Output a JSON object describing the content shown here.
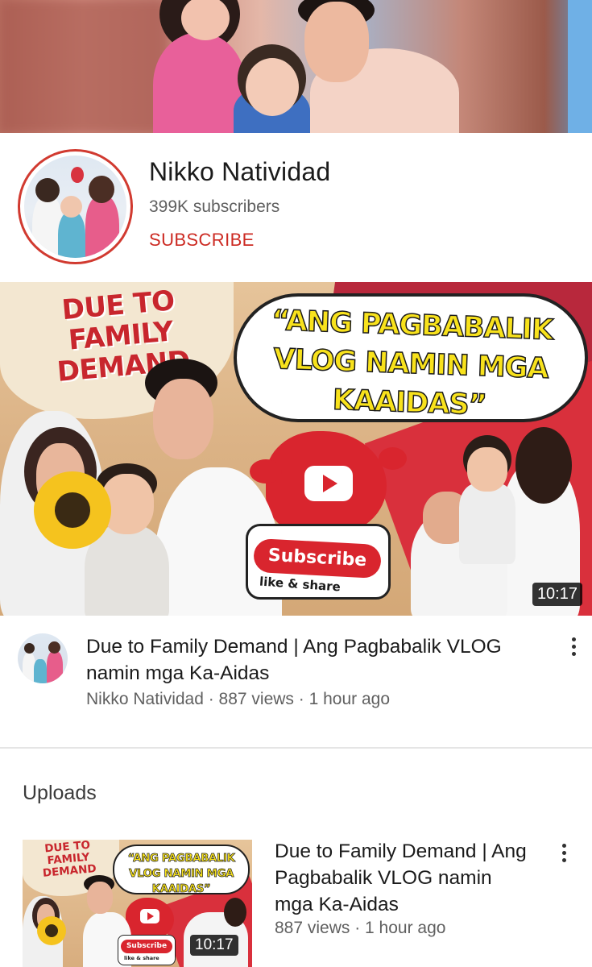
{
  "channel": {
    "name": "Nikko Natividad",
    "subscribers": "399K subscribers",
    "subscribe_label": "SUBSCRIBE",
    "accent_color": "#cc2a22"
  },
  "featured": {
    "thumbnail_text": {
      "headline_left": "DUE TO FAMILY DEMAND",
      "headline_right": "“ANG PAGBABALIK VLOG NAMIN MGA KAAIDAS”",
      "subscribe_pill": "Subscribe",
      "like_share": "like & share"
    },
    "duration": "10:17",
    "title": "Due to Family Demand | Ang Pagbabalik VLOG namin mga Ka-Aidas",
    "meta": "Nikko Natividad · 887 views · 1 hour ago",
    "menu_icon": "more-vert-icon"
  },
  "uploads": {
    "section_title": "Uploads",
    "items": [
      {
        "thumbnail_text": {
          "headline_left": "DUE TO FAMILY DEMAND",
          "headline_right": "“ANG PAGBABALIK VLOG NAMIN MGA KAAIDAS”",
          "subscribe_pill": "Subscribe",
          "like_share": "like & share"
        },
        "duration": "10:17",
        "title": "Due to Family Demand | Ang Pagbabalik VLOG namin mga Ka-Aidas",
        "meta": "887 views · 1 hour ago",
        "menu_icon": "more-vert-icon"
      }
    ]
  }
}
